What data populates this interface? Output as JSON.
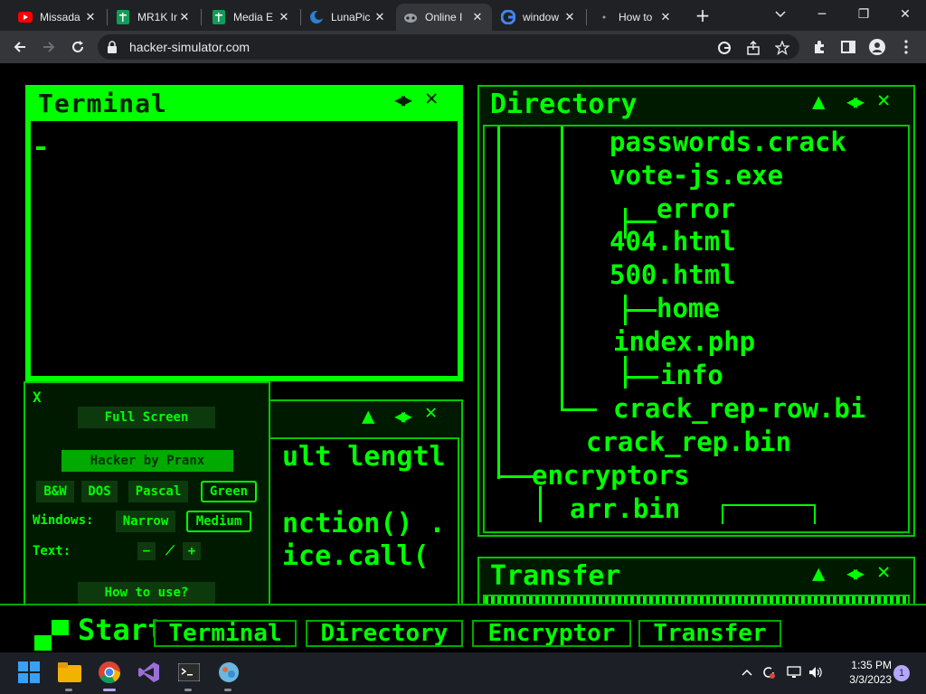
{
  "browser": {
    "tabs": [
      {
        "title": "Missada",
        "icon": "youtube-icon"
      },
      {
        "title": "MR1K In",
        "icon": "sheets-icon"
      },
      {
        "title": "Media E",
        "icon": "sheets-icon"
      },
      {
        "title": "LunaPic",
        "icon": "lunapic-icon"
      },
      {
        "title": "Online I",
        "icon": "hacker-icon"
      },
      {
        "title": "window",
        "icon": "google-icon"
      },
      {
        "title": "How to",
        "icon": "loading-icon"
      }
    ],
    "active_tab": 4,
    "url": "hacker-simulator.com"
  },
  "terminal": {
    "title": "Terminal",
    "close": "✕",
    "arrows": "◀▶"
  },
  "directory": {
    "title": "Directory",
    "up": "▲",
    "arrows": "◀▶",
    "close": "✕",
    "lines": [
      "passwords.crack",
      "vote-js.exe",
      "error",
      "404.html",
      "500.html",
      "home",
      "index.php",
      "info",
      "crack_rep-row.bi",
      "crack_rep.bin",
      "encryptors",
      "arr.bin"
    ]
  },
  "encryptor": {
    "up": "▲",
    "arrows": "◀▶",
    "close": "✕",
    "lines": [
      "ult lengtl",
      "nction() .",
      "ice.call("
    ]
  },
  "transfer": {
    "title": "Transfer",
    "up": "▲",
    "arrows": "◀▶",
    "close": "✕"
  },
  "settings": {
    "close": "X",
    "full_screen": "Full Screen",
    "hacker_by": "Hacker by Pranx",
    "themes": [
      "B&W",
      "DOS",
      "Pascal",
      "Green"
    ],
    "active_theme": "Green",
    "windows_label": "Windows:",
    "window_sizes": [
      "Narrow",
      "Medium"
    ],
    "active_window_size": "Medium",
    "text_label": "Text:",
    "text_controls": [
      "−",
      "⟋",
      "+"
    ],
    "how_to_use": "How to use?"
  },
  "pagebar": {
    "start": "Start",
    "tabs": [
      "Terminal",
      "Directory",
      "Encryptor",
      "Transfer"
    ]
  },
  "taskbar": {
    "time": "1:35 PM",
    "date": "3/3/2023",
    "notifications": "1"
  }
}
